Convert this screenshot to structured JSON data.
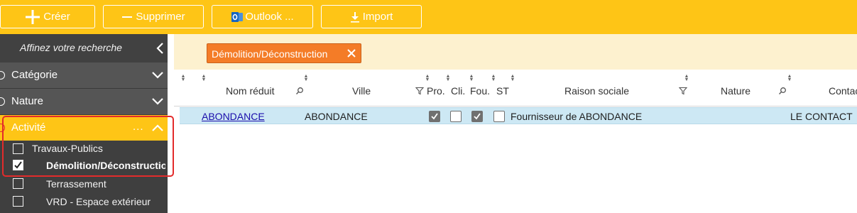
{
  "toolbar": {
    "create_label": "Créer",
    "delete_label": "Supprimer",
    "outlook_label": "Outlook ...",
    "import_label": "Import"
  },
  "sidebar": {
    "title": "Affinez votre recherche",
    "groups": [
      {
        "label": "Catégorie",
        "expanded": false
      },
      {
        "label": "Nature",
        "expanded": false
      },
      {
        "label": "Activité",
        "expanded": true,
        "more": "..."
      }
    ],
    "activity_items": [
      {
        "label": "Travaux-Publics",
        "checked": false
      },
      {
        "label": "Démolition/Déconstruction",
        "checked": true
      },
      {
        "label": "Terrassement",
        "checked": false
      },
      {
        "label": "VRD - Espace extérieur",
        "checked": false
      }
    ]
  },
  "filter": {
    "chip_label": "Démolition/Déconstruction"
  },
  "table": {
    "columns": {
      "nom_reduit": "Nom réduit",
      "ville": "Ville",
      "pro": "Pro.",
      "cli": "Cli.",
      "fou": "Fou.",
      "st": "ST",
      "raison_sociale": "Raison sociale",
      "nature": "Nature",
      "contact": "Contac"
    },
    "rows": [
      {
        "nom_reduit": "ABONDANCE",
        "ville": "ABONDANCE",
        "pro": true,
        "cli": false,
        "fou": true,
        "st": false,
        "raison_sociale": "Fournisseur de ABONDANCE",
        "nature": "",
        "contact": "LE CONTACT"
      }
    ]
  },
  "colors": {
    "toolbar": "#fec516",
    "sidebar": "#3f3f3f",
    "sidebar_row": "#555555",
    "active_group": "#fec516",
    "chip": "#f47c27",
    "filter_bar": "#fdf1cf",
    "selected_row": "#cde8f4",
    "highlight_border": "#e32b2b"
  },
  "icons": {
    "create": "plus-icon",
    "delete": "minus-icon",
    "outlook": "outlook-icon",
    "import": "download-icon",
    "collapse": "chevron-left-icon",
    "expand": "chevron-down-icon",
    "collapse_group": "chevron-up-icon",
    "chip_remove": "close-icon",
    "sort": "sort-icon",
    "search": "search-icon",
    "filter": "filter-icon"
  }
}
